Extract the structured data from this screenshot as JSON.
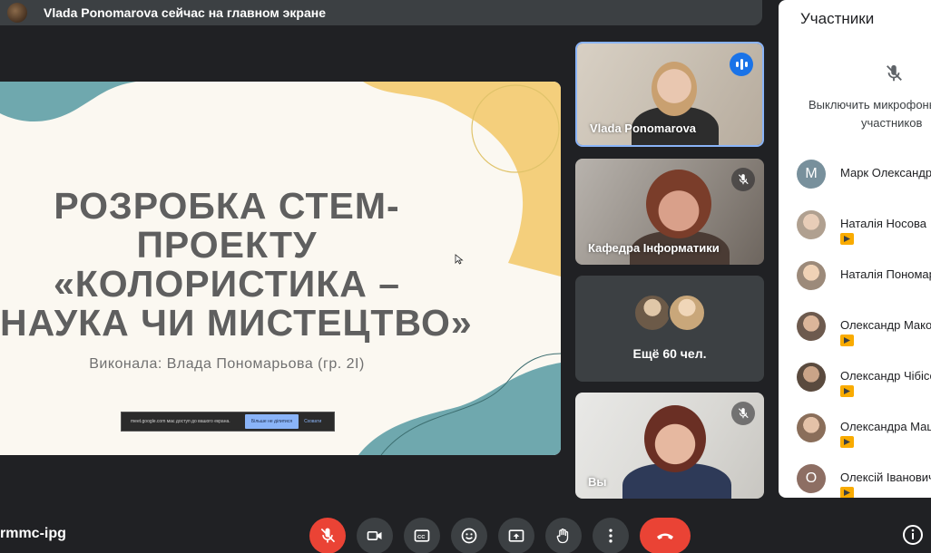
{
  "banner": {
    "text": "Vlada Ponomarova сейчас на главном экране"
  },
  "slide": {
    "title_lines": [
      "РОЗРОБКА СТЕМ-",
      "ПРОЕКТУ",
      "«КОЛОРИСТИКА –",
      "НАУКА ЧИ МИСТЕЦТВО»"
    ],
    "subtitle": "Виконала: Влада Пономарьова (гр. 2І)",
    "share_bar": {
      "text": "meet.google.com має доступ до вашого екрана.",
      "stop_label": "Більше не ділитися",
      "hide_label": "Сховати"
    }
  },
  "tiles": [
    {
      "name": "Vlada Ponomarova",
      "state": "speaking"
    },
    {
      "name": "Кафедра Інформатики",
      "state": "muted"
    },
    {
      "name": "Ещё 60 чел.",
      "state": "overflow"
    },
    {
      "name": "Вы",
      "state": "muted"
    }
  ],
  "panel": {
    "title": "Участники",
    "mute_all_line1": "Выключить микрофоны",
    "mute_all_line2": "участников",
    "participants": [
      {
        "name": "Марк Олександрович",
        "initial": "M",
        "avatar_color": "#78909c",
        "presenting": false
      },
      {
        "name": "Наталія Носова",
        "initial": "",
        "avatar_color": "#b0a090",
        "presenting": true
      },
      {
        "name": "Наталія Пономарова",
        "initial": "",
        "avatar_color": "#9c8a7a",
        "presenting": false
      },
      {
        "name": "Олександр Маковецький",
        "initial": "",
        "avatar_color": "#6d5a4e",
        "presenting": true
      },
      {
        "name": "Олександр Чібісов",
        "initial": "",
        "avatar_color": "#5a4a3e",
        "presenting": true
      },
      {
        "name": "Олександра Мацюк",
        "initial": "",
        "avatar_color": "#8a6e5a",
        "presenting": true
      },
      {
        "name": "Олексій Іванович",
        "initial": "O",
        "avatar_color": "#8d6e63",
        "presenting": true
      }
    ]
  },
  "bottom": {
    "meeting_code": "rmmc-ipg"
  },
  "colors": {
    "background": "#202124",
    "control": "#3c4043",
    "danger": "#ea4335",
    "accent": "#8ab4f8",
    "badge": "#f9ab00"
  }
}
